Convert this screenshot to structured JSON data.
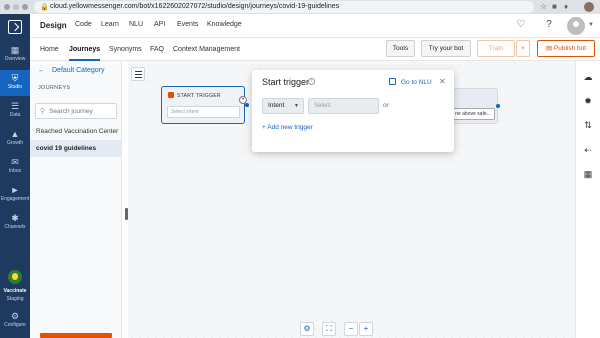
{
  "browser": {
    "url": "cloud.yellowmessenger.com/bot/x1622602027072/studio/design/journeys/covid-19-guidelines",
    "lock_icon": "lock-icon"
  },
  "rail": {
    "items": [
      {
        "label": "Overview",
        "icon": "grid-icon"
      },
      {
        "label": "Studio",
        "icon": "shield-icon",
        "active": true
      },
      {
        "label": "Data",
        "icon": "database-icon"
      },
      {
        "label": "Growth",
        "icon": "chart-icon"
      },
      {
        "label": "Inbox",
        "icon": "inbox-icon"
      },
      {
        "label": "Engagement",
        "icon": "megaphone-icon"
      },
      {
        "label": "Channels",
        "icon": "share-icon"
      }
    ],
    "bot_name": "Vaccinate",
    "bot_env": "Staging",
    "configure_label": "Configure"
  },
  "topnav": {
    "brand": "Design",
    "links": [
      "Code",
      "Learn",
      "NLU",
      "API",
      "Events",
      "Knowledge"
    ]
  },
  "subnav": {
    "tabs": [
      "Home",
      "Journeys",
      "Synonyms",
      "FAQ",
      "Context Management"
    ],
    "active_tab": "Journeys",
    "tools_label": "Tools",
    "try_bot_label": "Try your bot",
    "train_label": "Train",
    "publish_label": "Publish bot"
  },
  "journeys": {
    "back_label": "Default Category",
    "heading": "JOURNEYS",
    "search_placeholder": "Search journey",
    "items": [
      {
        "label": "Reached Vaccination Center",
        "active": false
      },
      {
        "label": "covid 19 guidelines",
        "active": true
      }
    ]
  },
  "canvas": {
    "node_title": "START TRIGGER",
    "node_input_placeholder": "Select intent",
    "node2_button": "ne above safe..."
  },
  "popup": {
    "title": "Start trigger",
    "nlu_link": "Go to NLU",
    "type_value": "Intent",
    "select_placeholder": "Select",
    "or_label": "or",
    "add_label": "+  Add new trigger"
  },
  "colors": {
    "rail": "#1e3a5f",
    "accent": "#1565c0",
    "publish": "#e65100"
  }
}
